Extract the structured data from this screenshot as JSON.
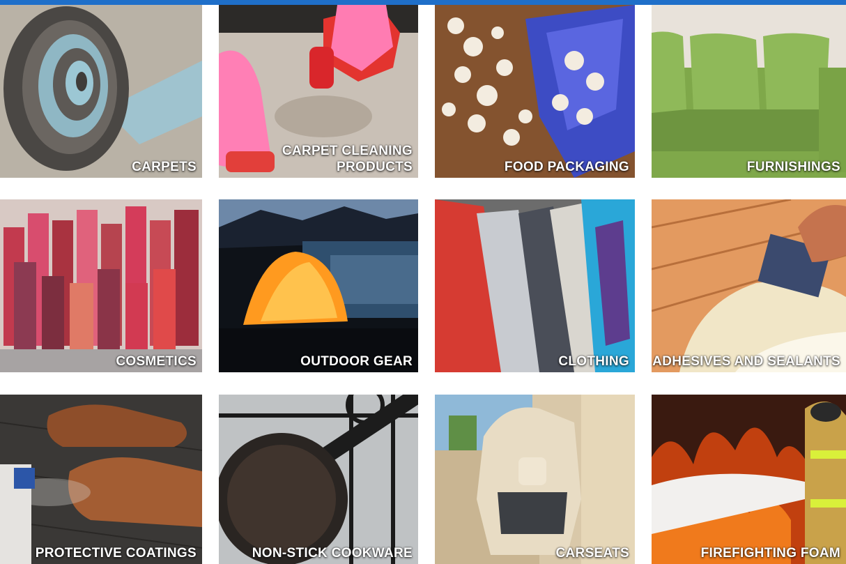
{
  "tiles": [
    {
      "label": "CARPETS"
    },
    {
      "label": "CARPET CLEANING\nPRODUCTS"
    },
    {
      "label": "FOOD PACKAGING"
    },
    {
      "label": "FURNISHINGS"
    },
    {
      "label": "COSMETICS"
    },
    {
      "label": "OUTDOOR GEAR"
    },
    {
      "label": "CLOTHING"
    },
    {
      "label": "ADHESIVES AND SEALANTS"
    },
    {
      "label": "PROTECTIVE COATINGS"
    },
    {
      "label": "NON-STICK COOKWARE"
    },
    {
      "label": "CARSEATS"
    },
    {
      "label": "FIREFIGHTING FOAM"
    }
  ],
  "colors": {
    "top_bar": "#1f6fc9",
    "label_text": "#ffffff"
  }
}
